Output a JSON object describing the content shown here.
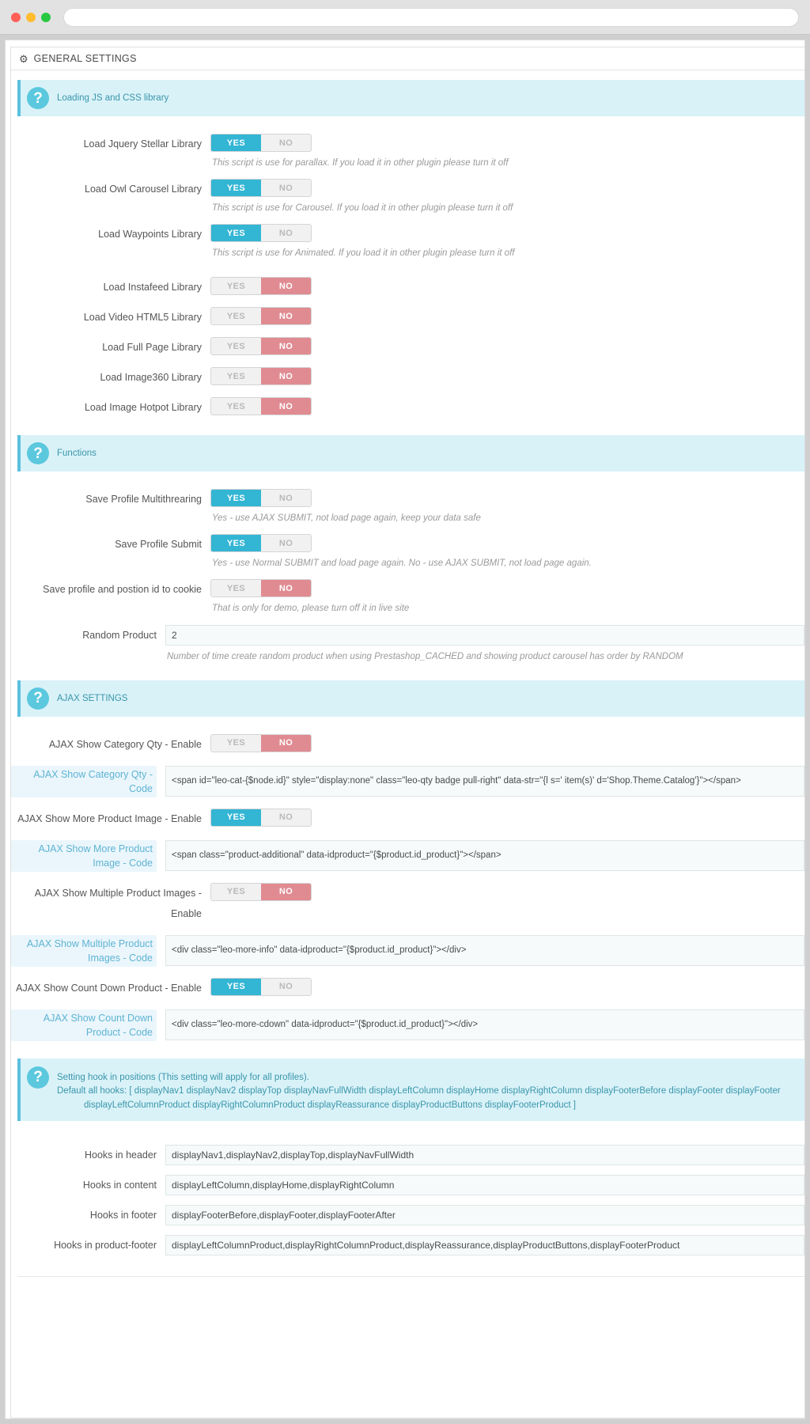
{
  "browser": {
    "url_value": ""
  },
  "panel": {
    "icon": "gears-icon",
    "title": "GENERAL SETTINGS"
  },
  "sections": {
    "loading": {
      "banner": "Loading JS and CSS library",
      "rows": [
        {
          "label": "Load Jquery Stellar Library",
          "yes": "YES",
          "no": "NO",
          "state": "yes",
          "help": "This script is use for parallax. If you load it in other plugin please turn it off"
        },
        {
          "label": "Load Owl Carousel Library",
          "yes": "YES",
          "no": "NO",
          "state": "yes",
          "help": "This script is use for Carousel. If you load it in other plugin please turn it off"
        },
        {
          "label": "Load Waypoints Library",
          "yes": "YES",
          "no": "NO",
          "state": "yes",
          "help": "This script is use for Animated. If you load it in other plugin please turn it off"
        },
        {
          "label": "Load Instafeed Library",
          "yes": "YES",
          "no": "NO",
          "state": "no",
          "help": ""
        },
        {
          "label": "Load Video HTML5 Library",
          "yes": "YES",
          "no": "NO",
          "state": "no",
          "help": ""
        },
        {
          "label": "Load Full Page Library",
          "yes": "YES",
          "no": "NO",
          "state": "no",
          "help": ""
        },
        {
          "label": "Load Image360 Library",
          "yes": "YES",
          "no": "NO",
          "state": "no",
          "help": ""
        },
        {
          "label": "Load Image Hotpot Library",
          "yes": "YES",
          "no": "NO",
          "state": "no",
          "help": ""
        }
      ]
    },
    "functions": {
      "banner": "Functions",
      "rows": [
        {
          "label": "Save Profile Multithrearing",
          "yes": "YES",
          "no": "NO",
          "state": "yes",
          "help": "Yes - use AJAX SUBMIT, not load page again, keep your data safe"
        },
        {
          "label": "Save Profile Submit",
          "yes": "YES",
          "no": "NO",
          "state": "yes",
          "help": "Yes - use Normal SUBMIT and load page again. No - use AJAX SUBMIT, not load page again."
        },
        {
          "label": "Save profile and postion id to cookie",
          "yes": "YES",
          "no": "NO",
          "state": "no",
          "help": "That is only for demo, please turn off it in live site"
        }
      ],
      "random_product": {
        "label": "Random Product",
        "value": "2",
        "help": "Number of time create random product when using Prestashop_CACHED and showing product carousel has order by RANDOM"
      }
    },
    "ajax": {
      "banner": "AJAX SETTINGS",
      "items": [
        {
          "enable_label": "AJAX Show Category Qty - Enable",
          "yes": "YES",
          "no": "NO",
          "state": "no",
          "code_label": "AJAX Show Category Qty - Code",
          "code_value": "<span id=\"leo-cat-{$node.id}\" style=\"display:none\" class=\"leo-qty badge pull-right\" data-str=\"{l s=' item(s)' d='Shop.Theme.Catalog'}\"></span>"
        },
        {
          "enable_label": "AJAX Show More Product Image - Enable",
          "yes": "YES",
          "no": "NO",
          "state": "yes",
          "code_label": "AJAX Show More Product Image - Code",
          "code_value": "<span class=\"product-additional\" data-idproduct=\"{$product.id_product}\"></span>"
        },
        {
          "enable_label": "AJAX Show Multiple Product Images - Enable",
          "yes": "YES",
          "no": "NO",
          "state": "no",
          "code_label": "AJAX Show Multiple Product Images - Code",
          "code_value": "<div class=\"leo-more-info\" data-idproduct=\"{$product.id_product}\"></div>"
        },
        {
          "enable_label": "AJAX Show Count Down Product - Enable",
          "yes": "YES",
          "no": "NO",
          "state": "yes",
          "code_label": "AJAX Show Count Down Product - Code",
          "code_value": "<div class=\"leo-more-cdown\" data-idproduct=\"{$product.id_product}\"></div>"
        }
      ]
    },
    "hooks": {
      "banner_line1": "Setting hook in positions (This setting will apply for all profiles).",
      "banner_line2": "Default all hooks: [ displayNav1  displayNav2  displayTop  displayNavFullWidth  displayLeftColumn  displayHome  displayRightColumn  displayFooterBefore  displayFooter  displayFooter",
      "banner_line3": "displayLeftColumnProduct  displayRightColumnProduct  displayReassurance  displayProductButtons  displayFooterProduct ]",
      "rows": [
        {
          "label": "Hooks in header",
          "value": "displayNav1,displayNav2,displayTop,displayNavFullWidth"
        },
        {
          "label": "Hooks in content",
          "value": "displayLeftColumn,displayHome,displayRightColumn"
        },
        {
          "label": "Hooks in footer",
          "value": "displayFooterBefore,displayFooter,displayFooterAfter"
        },
        {
          "label": "Hooks in product-footer",
          "value": "displayLeftColumnProduct,displayRightColumnProduct,displayReassurance,displayProductButtons,displayFooterProduct"
        }
      ]
    }
  },
  "colors": {
    "accent": "#33b5d4",
    "danger": "#e08b92",
    "banner_bg": "#d9f2f8",
    "banner_text": "#3a96ab"
  }
}
